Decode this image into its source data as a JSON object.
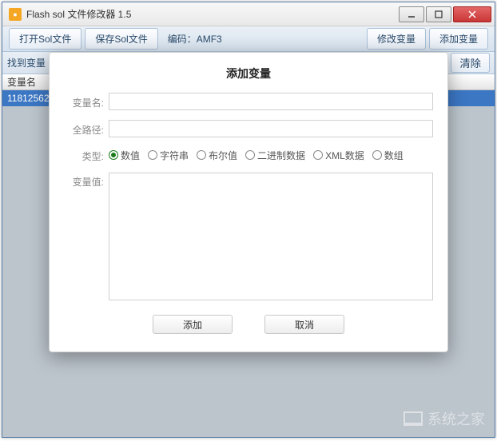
{
  "titlebar": {
    "title": "Flash sol 文件修改器 1.5"
  },
  "toolbar": {
    "open_btn": "打开Sol文件",
    "save_btn": "保存Sol文件",
    "encoding_label": "编码：AMF3",
    "modify_btn": "修改变量",
    "add_btn": "添加变量"
  },
  "searchbar": {
    "label": "找到变量",
    "clear_btn": "清除"
  },
  "table": {
    "header_varname": "变量名",
    "row_value": "11812562"
  },
  "modal": {
    "title": "添加变量",
    "varname_label": "变量名:",
    "fullpath_label": "全路径:",
    "type_label": "类型:",
    "type_options": {
      "number": "数值",
      "string": "字符串",
      "boolean": "布尔值",
      "binary": "二进制数据",
      "xml": "XML数据",
      "array": "数组"
    },
    "selected_type": "number",
    "varvalue_label": "变量值:",
    "add_btn": "添加",
    "cancel_btn": "取消"
  },
  "watermark": {
    "text": "系统之家"
  }
}
